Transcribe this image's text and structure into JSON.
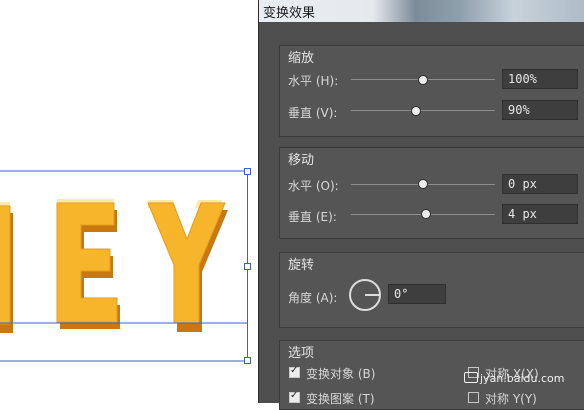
{
  "dialog": {
    "title": "变换效果",
    "scale": {
      "heading": "缩放",
      "horizontal": {
        "label": "水平 (H):",
        "value": "100%",
        "slider": 0.5
      },
      "vertical": {
        "label": "垂直 (V):",
        "value": "90%",
        "slider": 0.45
      }
    },
    "move": {
      "heading": "移动",
      "horizontal": {
        "label": "水平 (O):",
        "value": "0 px",
        "slider": 0.5
      },
      "vertical": {
        "label": "垂直 (E):",
        "value": "4 px",
        "slider": 0.52
      }
    },
    "rotate": {
      "heading": "旋转",
      "angle": {
        "label": "角度 (A):",
        "value": "0°"
      }
    },
    "options": {
      "heading": "选项",
      "transform_objects": {
        "label": "变换对象 (B)",
        "checked": true
      },
      "transform_patterns": {
        "label": "变换图案 (T)",
        "checked": true
      },
      "reflect_x": {
        "label": "对称 X(X)",
        "checked": false
      },
      "reflect_y": {
        "label": "对称 Y(Y)",
        "checked": false
      }
    }
  },
  "canvas": {
    "letters": [
      "N",
      "E",
      "Y"
    ],
    "fill_color": "#f7b52c",
    "shadow_color": "#c8780f",
    "highlight_color": "#ffe9a8",
    "selection_color": "#3f5fc8"
  },
  "watermark": "jyan.baidu.com"
}
